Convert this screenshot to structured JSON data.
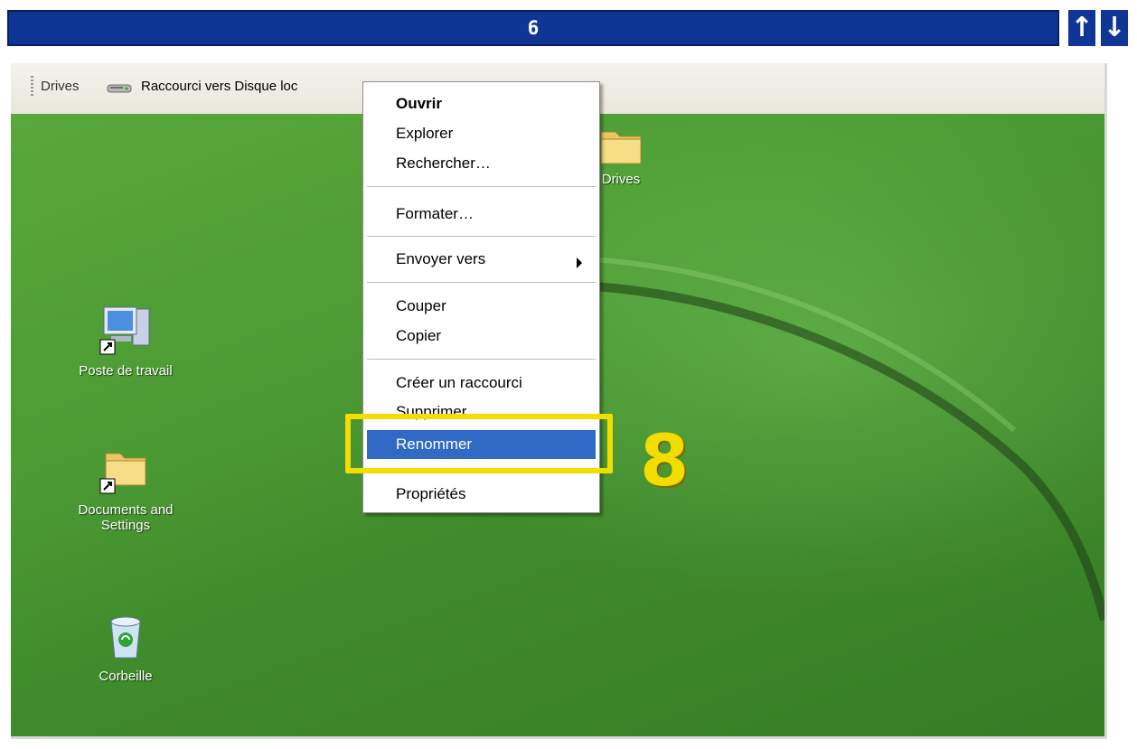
{
  "step": {
    "number": "6",
    "up_arrow": "↑",
    "down_arrow": "↓"
  },
  "toolbar": {
    "drives_label": "Drives",
    "shortcut_label": "Raccourci vers Disque loc"
  },
  "desktop": {
    "drives_folder": "Drives",
    "poste_de_travail": "Poste de travail",
    "documents_line1": "Documents and",
    "documents_line2": "Settings",
    "corbeille": "Corbeille"
  },
  "context_menu": {
    "open": "Ouvrir",
    "explore": "Explorer",
    "search": "Rechercher…",
    "format": "Formater…",
    "send_to": "Envoyer vers",
    "cut": "Couper",
    "copy": "Copier",
    "create_shortcut": "Créer un raccourci",
    "delete": "Supprimer",
    "rename": "Renommer",
    "properties": "Propriétés"
  },
  "callout": {
    "number": "8",
    "color": "#f3dc00"
  },
  "colors": {
    "header_bar": "#0f3694",
    "highlight": "#316ac5"
  }
}
